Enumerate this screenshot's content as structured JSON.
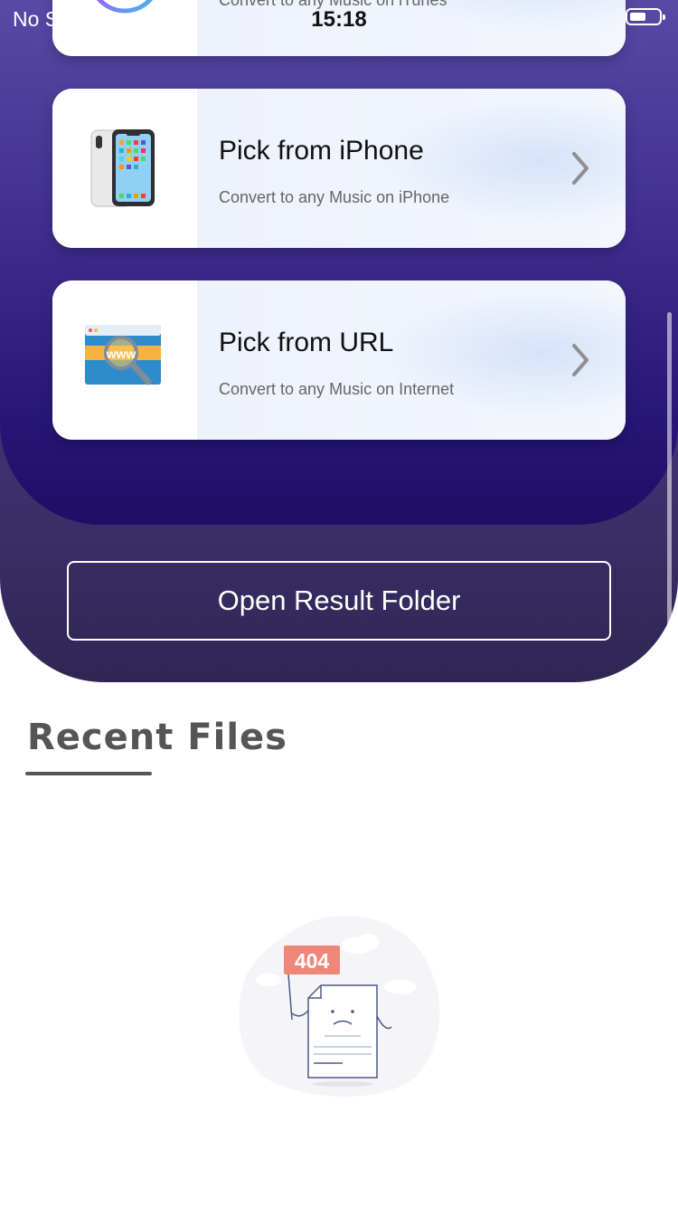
{
  "status_bar": {
    "carrier": "No S",
    "time": "15:18",
    "battery_level_pct": 55
  },
  "options": [
    {
      "title": "",
      "subtitle": "Convert to any Music on iTunes",
      "icon": "itunes-icon"
    },
    {
      "title": "Pick from iPhone",
      "subtitle": "Convert to any Music on iPhone",
      "icon": "iphone-icon"
    },
    {
      "title": "Pick from URL",
      "subtitle": "Convert to any Music on Internet",
      "icon": "web-url-search-icon"
    }
  ],
  "open_result_button": {
    "label": "Open Result Folder"
  },
  "recent": {
    "title": "Recent Files",
    "empty_state_badge": "404"
  },
  "colors": {
    "hero_top": "#584aa6",
    "hero_bottom": "#1f0e66",
    "panel_bottom": "#2f2653",
    "badge": "#f0867a"
  }
}
